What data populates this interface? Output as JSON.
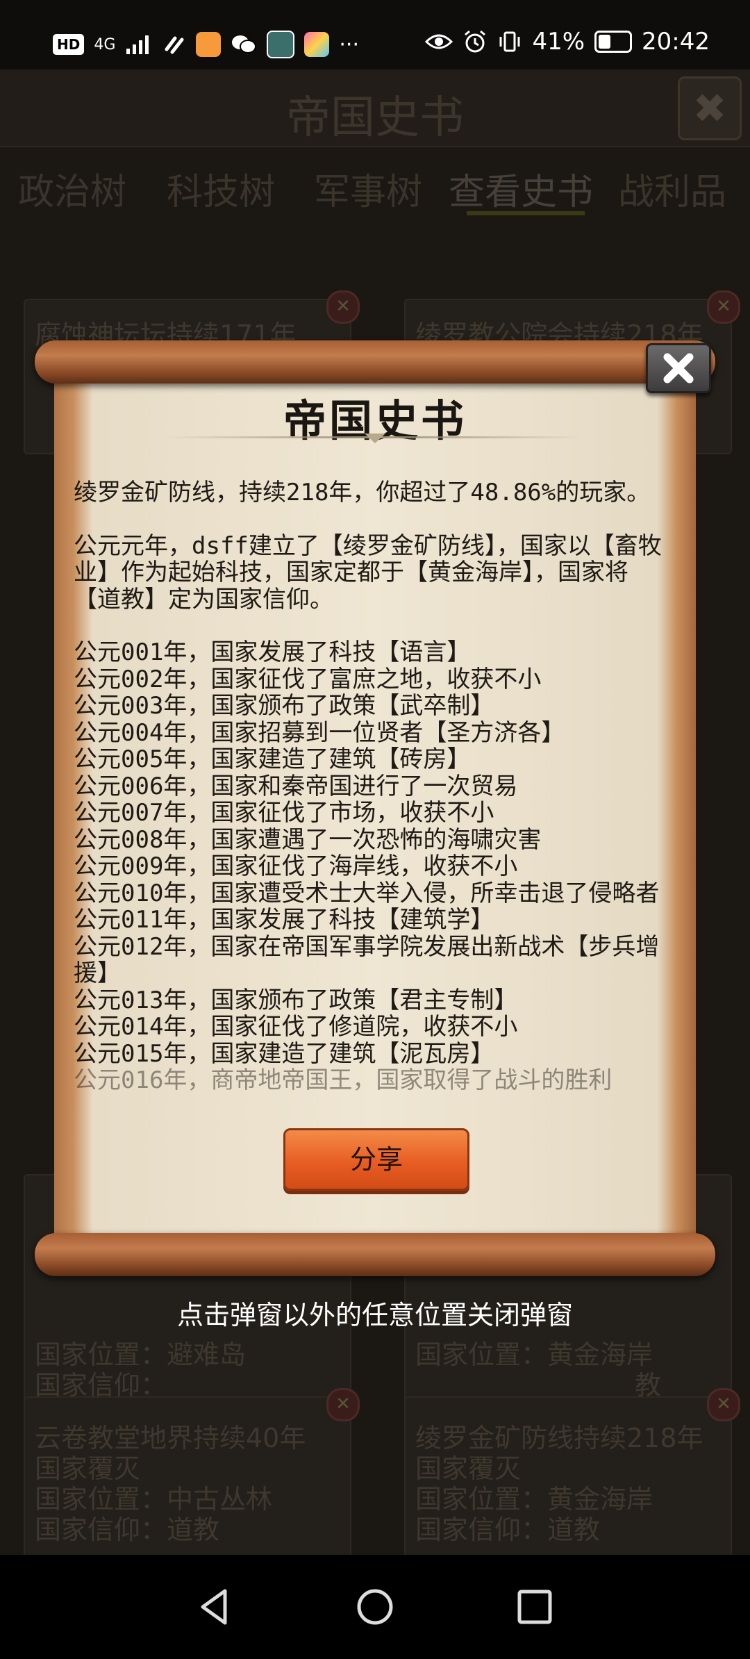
{
  "status_bar": {
    "hd": "HD",
    "network": "4G",
    "more": "···",
    "battery": "41%",
    "time": "20:42",
    "battery_level": 0.41
  },
  "background": {
    "title": "帝国史书",
    "tabs": [
      "政治树",
      "科技树",
      "军事树",
      "查看史书",
      "战利品"
    ],
    "active_tab": "查看史书",
    "cards": [
      {
        "lines": [
          "腐蚀神坛坛持续171年"
        ]
      },
      {
        "lines": [
          "绫罗教公院会持续218年"
        ]
      },
      {
        "lines": [
          "",
          "",
          "国家位置：避难岛",
          "国家信仰："
        ]
      },
      {
        "lines": [
          "",
          "",
          "国家位置：黄金海岸",
          "教"
        ]
      },
      {
        "lines": [
          "云卷教堂地界持续40年",
          "国家覆灭",
          "国家位置：中古丛林",
          "国家信仰：道教"
        ]
      },
      {
        "lines": [
          "绫罗金矿防线持续218年",
          "国家覆灭",
          "国家位置：黄金海岸",
          "国家信仰：道教"
        ]
      }
    ]
  },
  "modal": {
    "title": "帝国史书",
    "summary": "绫罗金矿防线，持续218年，你超过了48.86%的玩家。",
    "founding": "公元元年，dsff建立了【绫罗金矿防线】，国家以【畜牧业】作为起始科技，国家定都于【黄金海岸】，国家将【道教】定为国家信仰。",
    "events": [
      "公元001年，国家发展了科技【语言】",
      "公元002年，国家征伐了富庶之地，收获不小",
      "公元003年，国家颁布了政策【武卒制】",
      "公元004年，国家招募到一位贤者【圣方济各】",
      "公元005年，国家建造了建筑【砖房】",
      "公元006年，国家和秦帝国进行了一次贸易",
      "公元007年，国家征伐了市场，收获不小",
      "公元008年，国家遭遇了一次恐怖的海啸灾害",
      "公元009年，国家征伐了海岸线，收获不小",
      "公元010年，国家遭受术士大举入侵，所幸击退了侵略者",
      "公元011年，国家发展了科技【建筑学】",
      "公元012年，国家在帝国军事学院发展出新战术【步兵增援】",
      "公元013年，国家颁布了政策【君主专制】",
      "公元014年，国家征伐了修道院，收获不小",
      "公元015年，国家建造了建筑【泥瓦房】",
      "公元016年，商帝地帝国王，国家取得了战斗的胜利"
    ],
    "share_label": "分享",
    "hint": "点击弹窗以外的任意位置关闭弹窗"
  },
  "icons": {
    "close": "close-icon",
    "back": "back-triangle-icon",
    "home": "home-circle-icon",
    "recents": "recents-square-icon"
  },
  "colors": {
    "share_button": "#e85d23",
    "parchment": "#efe6d3",
    "scroll_rod": "#b06a3c"
  }
}
